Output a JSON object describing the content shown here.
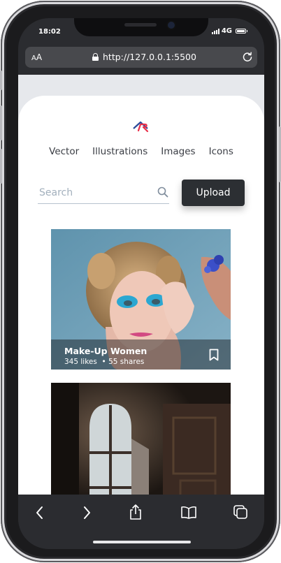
{
  "status_bar": {
    "time": "18:02",
    "network": "4G"
  },
  "browser": {
    "text_size_small": "A",
    "text_size_big": "A",
    "url": "http://127.0.0.1:5500"
  },
  "nav": [
    "Vector",
    "Illustrations",
    "Images",
    "Icons"
  ],
  "search": {
    "placeholder": "Search",
    "value": ""
  },
  "upload_label": "Upload",
  "cards": [
    {
      "title": "Make-Up Women",
      "likes": "345 likes",
      "separator": "•",
      "shares": "55 shares"
    }
  ],
  "colors": {
    "logo_red": "#e8304a",
    "logo_blue": "#2b4a9a",
    "button_dark": "#2c2f33"
  },
  "icons": [
    "logo-icon",
    "lock-icon",
    "reload-icon",
    "search-icon",
    "bookmark-icon",
    "back-icon",
    "forward-icon",
    "share-icon",
    "bookmarks-book-icon",
    "tabs-icon"
  ]
}
